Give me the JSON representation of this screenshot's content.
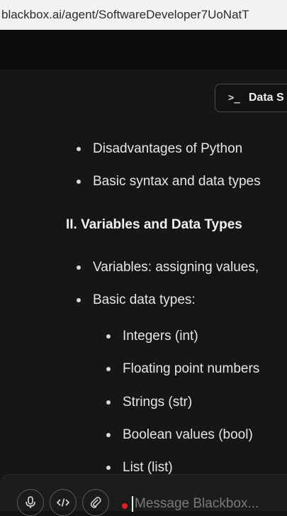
{
  "browser": {
    "url": "blackbox.ai/agent/SoftwareDeveloper7UoNatT"
  },
  "header": {
    "data_button_label": "Data S"
  },
  "content": {
    "bullets_top": [
      "Disadvantages of Python",
      "Basic syntax and data types"
    ],
    "section_heading": "II. Variables and Data Types",
    "bullets_section": [
      "Variables: assigning values,",
      "Basic data types:"
    ],
    "sub_bullets": [
      "Integers (int)",
      "Floating point numbers",
      "Strings (str)",
      "Boolean values (bool)",
      "List (list)"
    ]
  },
  "input": {
    "placeholder": "Message Blackbox..."
  },
  "icons": {
    "terminal": "terminal-icon",
    "mic": "microphone-icon",
    "code": "code-icon",
    "attach": "paperclip-icon"
  },
  "colors": {
    "background": "#161616",
    "accent_record": "#e02020"
  }
}
